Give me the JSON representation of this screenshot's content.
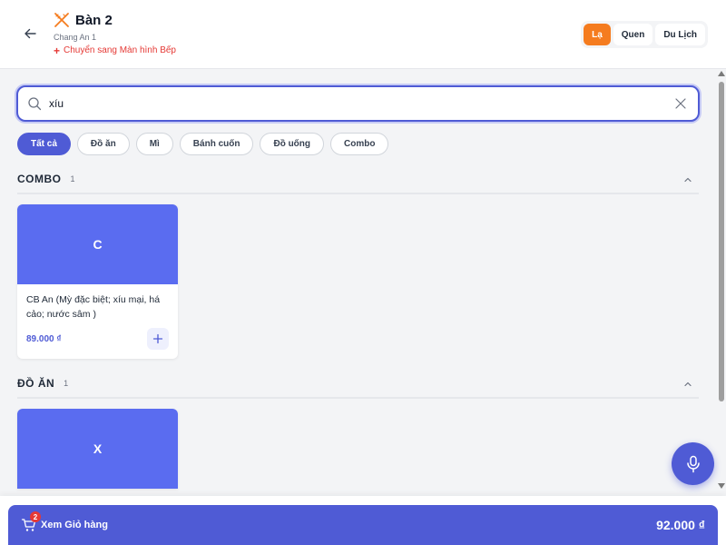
{
  "header": {
    "title": "Bàn 2",
    "subtitle": "Chang An 1",
    "kitchen_link": "Chuyển sang Màn hình Bếp",
    "customer_types": [
      "Lạ",
      "Quen",
      "Du Lịch"
    ],
    "active_customer_type": "Lạ"
  },
  "search": {
    "value": "xíu",
    "placeholder": ""
  },
  "categories": [
    "Tất cả",
    "Đồ ăn",
    "Mì",
    "Bánh cuốn",
    "Đồ uống",
    "Combo"
  ],
  "active_category": "Tất cả",
  "sections": [
    {
      "title": "COMBO",
      "count": "1",
      "items": [
        {
          "thumb_letter": "C",
          "name": "CB An (Mỳ đặc biệt; xíu mại, há cảo; nước sâm )",
          "price": "89.000 ₫"
        }
      ]
    },
    {
      "title": "ĐỒ ĂN",
      "count": "1",
      "items": [
        {
          "thumb_letter": "X"
        }
      ]
    }
  ],
  "cart": {
    "label": "Xem Giỏ hàng",
    "badge": "2",
    "total": "92.000 ₫"
  },
  "colors": {
    "primary": "#4f5bd5",
    "accent_orange": "#f57c1f",
    "danger": "#e53935",
    "thumb": "#5a6cf0"
  }
}
